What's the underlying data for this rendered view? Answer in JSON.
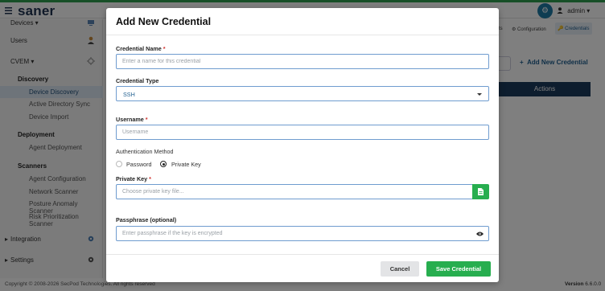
{
  "app": {
    "brand": "saner",
    "user": "admin",
    "user_caret": "▾",
    "footer_copyright": "Copyright © 2008-2026 SecPod Technologies. All rights reserved",
    "footer_version_label": "Version",
    "footer_version": "6.6.0.0"
  },
  "sidebar": {
    "items": [
      {
        "label": "Devices ▾",
        "icon": "devices-icon"
      },
      {
        "label": "Users",
        "icon": "user-icon"
      },
      {
        "label": "CVEM ▾",
        "icon": "cvem-icon"
      }
    ],
    "sections": [
      {
        "title": "Discovery",
        "items": [
          "Device Discovery",
          "Active Directory Sync",
          "Device Import"
        ]
      },
      {
        "title": "Deployment",
        "items": [
          "Agent Deployment"
        ]
      },
      {
        "title": "Scanners",
        "items": [
          "Agent Configuration",
          "Network Scanner",
          "Posture Anomaly Scanner",
          "Risk Prioritization Scanner"
        ]
      }
    ],
    "bottom": [
      {
        "label": "Integration",
        "icon": "gear-icon"
      },
      {
        "label": "Settings",
        "icon": "gear-icon"
      }
    ],
    "active_item": "Device Discovery"
  },
  "right_pane": {
    "tabs": [
      "ts",
      "Configuration",
      "Credentials"
    ],
    "active_tab": "Credentials",
    "add_button": "Add New Credential",
    "table_header": "Actions"
  },
  "modal": {
    "title": "Add New Credential",
    "name_label": "Credential Name",
    "name_placeholder": "Enter a name for this credential",
    "name_value": "",
    "type_label": "Credential Type",
    "type_value": "SSH",
    "username_label": "Username",
    "username_placeholder": "Username",
    "username_value": "",
    "auth_label": "Authentication Method",
    "auth_options": [
      "Password",
      "Private Key"
    ],
    "auth_selected": "Private Key",
    "key_label": "Private Key",
    "key_placeholder": "Choose private key file...",
    "passphrase_label": "Passphrase (optional)",
    "passphrase_placeholder": "Enter passphrase if the key is encrypted",
    "required_mark": "*",
    "cancel_label": "Cancel",
    "save_label": "Save Credential"
  },
  "colors": {
    "accent": "#27ae4f",
    "brand_navy": "#1b3a5c",
    "link": "#1f5e8f",
    "required": "#d0312d",
    "overlay": "rgba(0,0,0,0.5)"
  }
}
